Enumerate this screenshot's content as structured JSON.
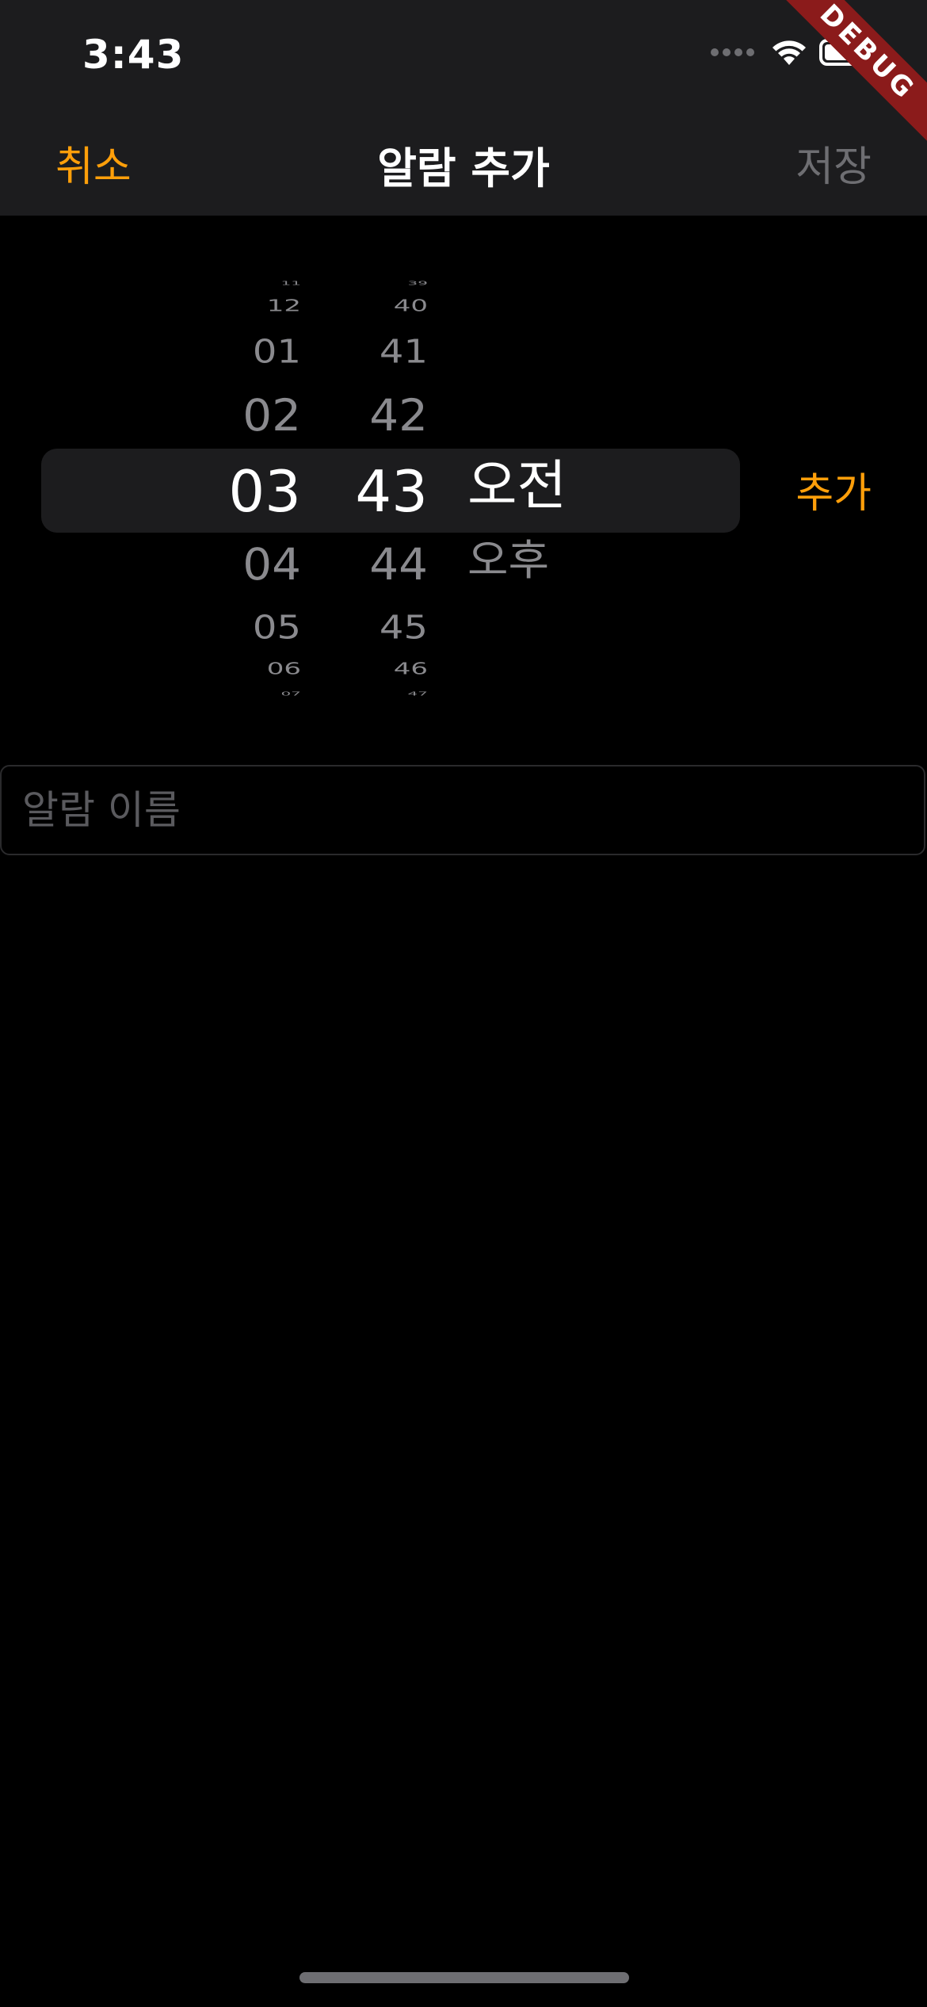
{
  "status_bar": {
    "time": "3:43",
    "wifi_icon": "wifi-icon",
    "battery_icon": "battery-icon"
  },
  "nav": {
    "cancel": "취소",
    "title": "알람 추가",
    "save": "저장"
  },
  "debug_banner": "DEBUG",
  "picker": {
    "hour": {
      "above": [
        "11",
        "12",
        "01",
        "02"
      ],
      "selected": "03",
      "below": [
        "04",
        "05",
        "06",
        "07"
      ]
    },
    "minute": {
      "above": [
        "39",
        "40",
        "41",
        "42"
      ],
      "selected": "43",
      "below": [
        "44",
        "45",
        "46",
        "47"
      ]
    },
    "period": {
      "selected": "오전",
      "below": [
        "오후"
      ]
    }
  },
  "add_action": "추가",
  "name_field": {
    "placeholder": "알람 이름",
    "value": ""
  },
  "colors": {
    "accent": "#ff9f0a",
    "bar_background": "#1c1c1e",
    "disabled": "#6e6e72"
  }
}
